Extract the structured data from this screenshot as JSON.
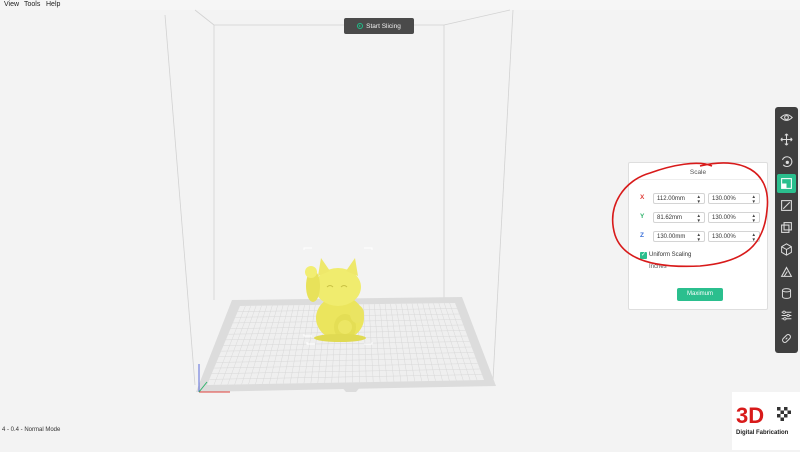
{
  "menu": [
    "View",
    "Tools",
    "Help"
  ],
  "toolbar_top": {
    "start_label": "Start Slicing"
  },
  "side_toolbar": {
    "icons": [
      "eye-icon",
      "move-icon",
      "rotate-icon",
      "scale-icon",
      "mirror-icon",
      "cut-icon",
      "multiply-icon",
      "support-icon",
      "cylinder-icon",
      "settings-sliders-icon",
      "link-icon"
    ],
    "active": "scale-icon"
  },
  "scale_panel": {
    "title": "Scale",
    "rows": [
      {
        "axis": "X",
        "size": "112.00mm",
        "percent": "130.00%",
        "color": "#e0413b"
      },
      {
        "axis": "Y",
        "size": "81.62mm",
        "percent": "130.00%",
        "color": "#2fb36b"
      },
      {
        "axis": "Z",
        "size": "130.00mm",
        "percent": "130.00%",
        "color": "#3a6fd8"
      }
    ],
    "uniform_label": "Uniform Scaling",
    "uniform_checked": true,
    "inches_label": "Inches",
    "maximum_label": "Maximum"
  },
  "status_text": "4 - 0.4 - Normal Mode",
  "logo": {
    "text": "3D",
    "subtitle": "Digital Fabrication"
  },
  "colors": {
    "accent": "#2bbf8e",
    "model": "#f0ec6e",
    "annotation": "#d81a1a"
  }
}
